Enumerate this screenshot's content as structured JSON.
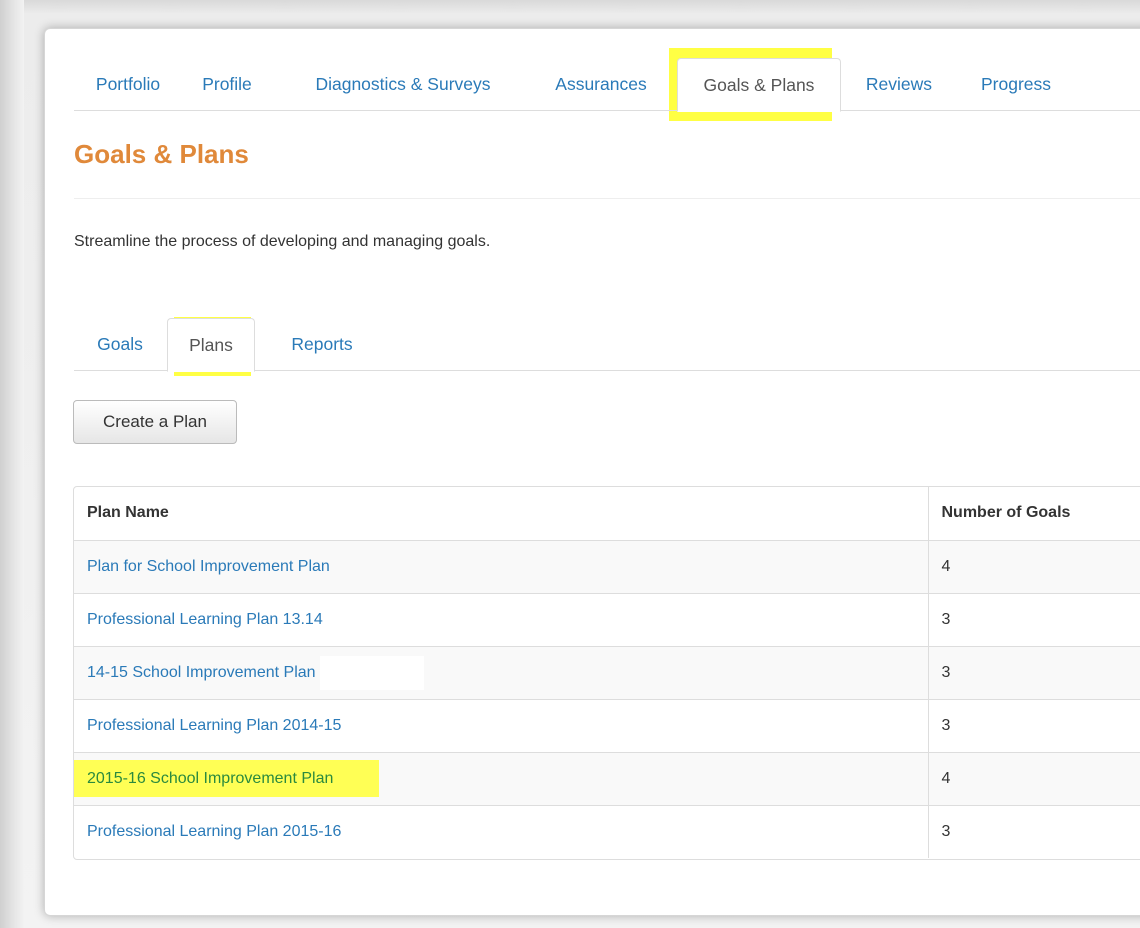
{
  "nav": {
    "tabs": [
      {
        "label": "Portfolio"
      },
      {
        "label": "Profile"
      },
      {
        "label": "Diagnostics & Surveys"
      },
      {
        "label": "Assurances"
      },
      {
        "label": "Goals & Plans"
      },
      {
        "label": "Reviews"
      },
      {
        "label": "Progress"
      }
    ],
    "active": "Goals & Plans"
  },
  "page": {
    "title": "Goals & Plans",
    "description": "Streamline the process of developing and managing goals."
  },
  "subtabs": {
    "tabs": [
      {
        "label": "Goals"
      },
      {
        "label": "Plans"
      },
      {
        "label": "Reports"
      }
    ],
    "active": "Plans"
  },
  "toolbar": {
    "create_label": "Create a Plan"
  },
  "table": {
    "headers": {
      "name": "Plan Name",
      "goals": "Number of Goals"
    },
    "rows": [
      {
        "name": "Plan for School Improvement Plan",
        "goals": "4"
      },
      {
        "name": "Professional Learning Plan 13.14",
        "goals": "3"
      },
      {
        "name": "14-15 School Improvement Plan",
        "goals": "3"
      },
      {
        "name": "Professional Learning Plan 2014-15",
        "goals": "3"
      },
      {
        "name": "2015-16 School Improvement Plan",
        "goals": "4"
      },
      {
        "name": "Professional Learning Plan 2015-16",
        "goals": "3"
      }
    ]
  },
  "colors": {
    "link": "#2a7ab8",
    "title": "#e0893a",
    "highlight": "#ffff44"
  }
}
